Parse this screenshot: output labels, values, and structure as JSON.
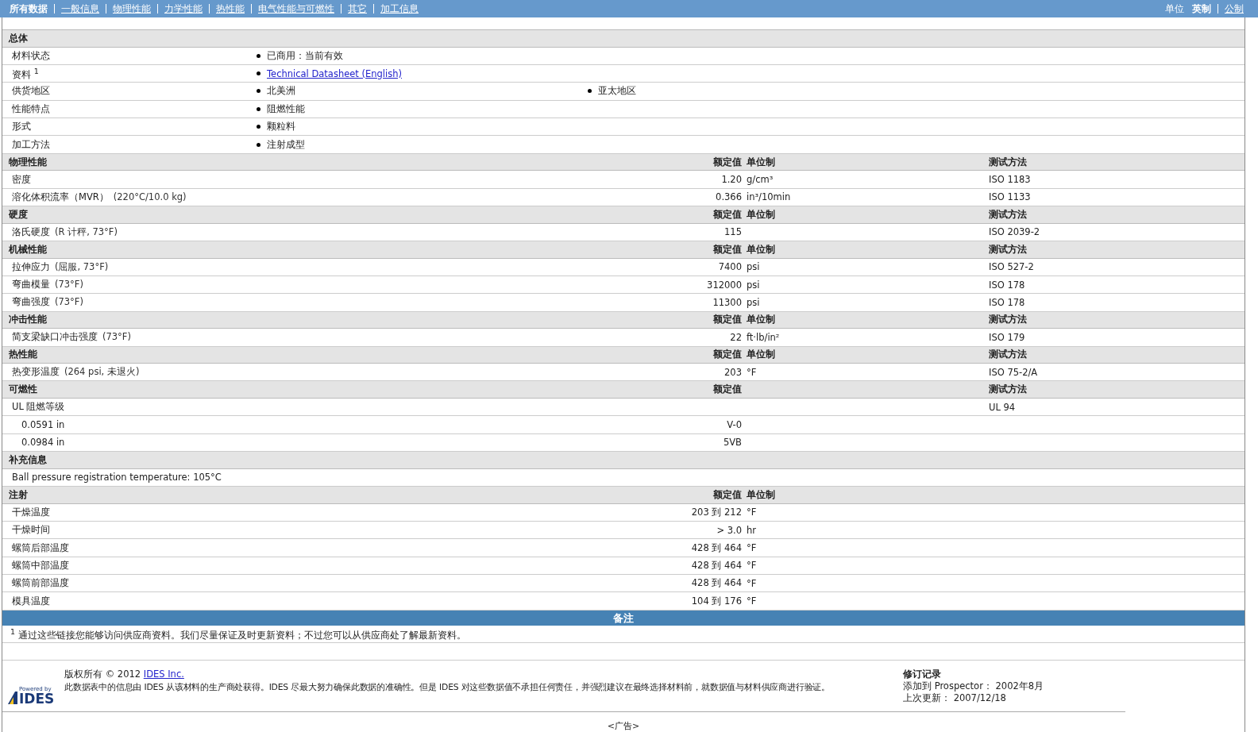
{
  "nav": {
    "tabs": [
      {
        "label": "所有数据",
        "selected": true
      },
      {
        "label": "一般信息",
        "selected": false
      },
      {
        "label": "物理性能",
        "selected": false
      },
      {
        "label": "力学性能",
        "selected": false
      },
      {
        "label": "热性能",
        "selected": false
      },
      {
        "label": "电气性能与可燃性",
        "selected": false
      },
      {
        "label": "其它",
        "selected": false
      },
      {
        "label": "加工信息",
        "selected": false
      }
    ],
    "units_label": "单位",
    "units": [
      {
        "label": "英制",
        "selected": true
      },
      {
        "label": "公制",
        "selected": false
      }
    ]
  },
  "general": {
    "title": "总体",
    "rows": [
      {
        "label": "材料状态",
        "items": [
          {
            "kind": "text",
            "text": "已商用：当前有效"
          }
        ]
      },
      {
        "label": "资料 $^{1}$",
        "items": [
          {
            "kind": "link",
            "text": "Technical Datasheet (English)"
          }
        ]
      },
      {
        "label": "供货地区",
        "items": [
          {
            "kind": "text",
            "text": "北美洲"
          },
          {
            "kind": "text",
            "text": "亚太地区"
          }
        ]
      },
      {
        "label": "性能特点",
        "items": [
          {
            "kind": "text",
            "text": "阻燃性能"
          }
        ]
      },
      {
        "label": "形式",
        "items": [
          {
            "kind": "text",
            "text": "颗粒料"
          }
        ]
      },
      {
        "label": "加工方法",
        "items": [
          {
            "kind": "text",
            "text": "注射成型"
          }
        ]
      }
    ]
  },
  "sections": [
    {
      "kind": "table",
      "title": "物理性能",
      "value_header": "额定值",
      "unit_header": "单位制",
      "method_header": "测试方法",
      "rows": [
        {
          "label": "密度",
          "value": "1.20",
          "unit": "g/cm³",
          "method": "ISO 1183"
        },
        {
          "label": "溶化体积流率（MVR）",
          "condition": "(220°C/10.0 kg)",
          "value": "0.366",
          "unit": "in³/10min",
          "method": "ISO 1133"
        }
      ]
    },
    {
      "kind": "table",
      "title": "硬度",
      "value_header": "额定值",
      "unit_header": "单位制",
      "method_header": "测试方法",
      "rows": [
        {
          "label": "洛氏硬度",
          "condition": "(R 计秤, 73°F)",
          "value": "115",
          "method": "ISO 2039-2"
        }
      ]
    },
    {
      "kind": "table",
      "title": "机械性能",
      "value_header": "额定值",
      "unit_header": "单位制",
      "method_header": "测试方法",
      "rows": [
        {
          "label": "拉伸应力",
          "condition": "(屈服, 73°F)",
          "value": "7400",
          "unit": "psi",
          "method": "ISO 527-2"
        },
        {
          "label": "弯曲模量",
          "condition": "(73°F)",
          "value": "312000",
          "unit": "psi",
          "method": "ISO 178"
        },
        {
          "label": "弯曲强度",
          "condition": "(73°F)",
          "value": "11300",
          "unit": "psi",
          "method": "ISO 178"
        }
      ]
    },
    {
      "kind": "table",
      "title": "冲击性能",
      "value_header": "额定值",
      "unit_header": "单位制",
      "method_header": "测试方法",
      "rows": [
        {
          "label": "简支梁缺口冲击强度",
          "condition": "(73°F)",
          "value": "22",
          "unit": "ft·lb/in²",
          "method": "ISO 179"
        }
      ]
    },
    {
      "kind": "table",
      "title": "热性能",
      "value_header": "额定值",
      "unit_header": "单位制",
      "method_header": "测试方法",
      "rows": [
        {
          "label": "热变形温度",
          "condition": "(264 psi, 未退火)",
          "value": "203",
          "unit": "°F",
          "method": "ISO 75-2/A"
        }
      ]
    },
    {
      "kind": "table",
      "title": "可燃性",
      "value_header": "额定值",
      "method_header": "测试方法",
      "rows": [
        {
          "label": "UL 阻燃等级",
          "method": "UL 94",
          "children": [
            {
              "label": "0.0591 in",
              "value": "V-0"
            },
            {
              "label": "0.0984 in",
              "value": "5VB"
            }
          ]
        }
      ]
    },
    {
      "kind": "text",
      "title": "补充信息",
      "text": "Ball pressure registration temperature: 105°C"
    },
    {
      "kind": "table",
      "title": "注射",
      "value_header": "额定值",
      "unit_header": "单位制",
      "rows": [
        {
          "label": "干燥温度",
          "value": "203 到  212",
          "unit": "°F"
        },
        {
          "label": "干燥时间",
          "value": "> 3.0",
          "unit": "hr"
        },
        {
          "label": "螺筒后部温度",
          "value": "428 到  464",
          "unit": "°F"
        },
        {
          "label": "螺筒中部温度",
          "value": "428 到  464",
          "unit": "°F"
        },
        {
          "label": "螺筒前部温度",
          "value": "428 到  464",
          "unit": "°F"
        },
        {
          "label": "模具温度",
          "value": "104 到  176",
          "unit": "°F"
        }
      ]
    }
  ],
  "notes": {
    "title": "备注",
    "text": "$^{1}$ 通过这些链接您能够访问供应商资料。我们尽量保证及时更新资料；不过您可以从供应商处了解最新资料。"
  },
  "footer": {
    "logo_top": "Powered by",
    "logo_name": "IDES",
    "copyright": "版权所有  © 2012",
    "company_link": "IDES Inc.",
    "disclaimer": "此数据表中的信息由 IDES 从该材料的生产商处获得。IDES 尽最大努力确保此数据的准确性。但是 IDES 对这些数据值不承担任何责任，并强烈建议在最终选择材料前，就数据值与材料供应商进行验证。",
    "revision_title": "修订记录",
    "added": "添加到 Prospector：  2002年8月",
    "updated": "上次更新：  2007/12/18"
  },
  "ad": "<广告>"
}
